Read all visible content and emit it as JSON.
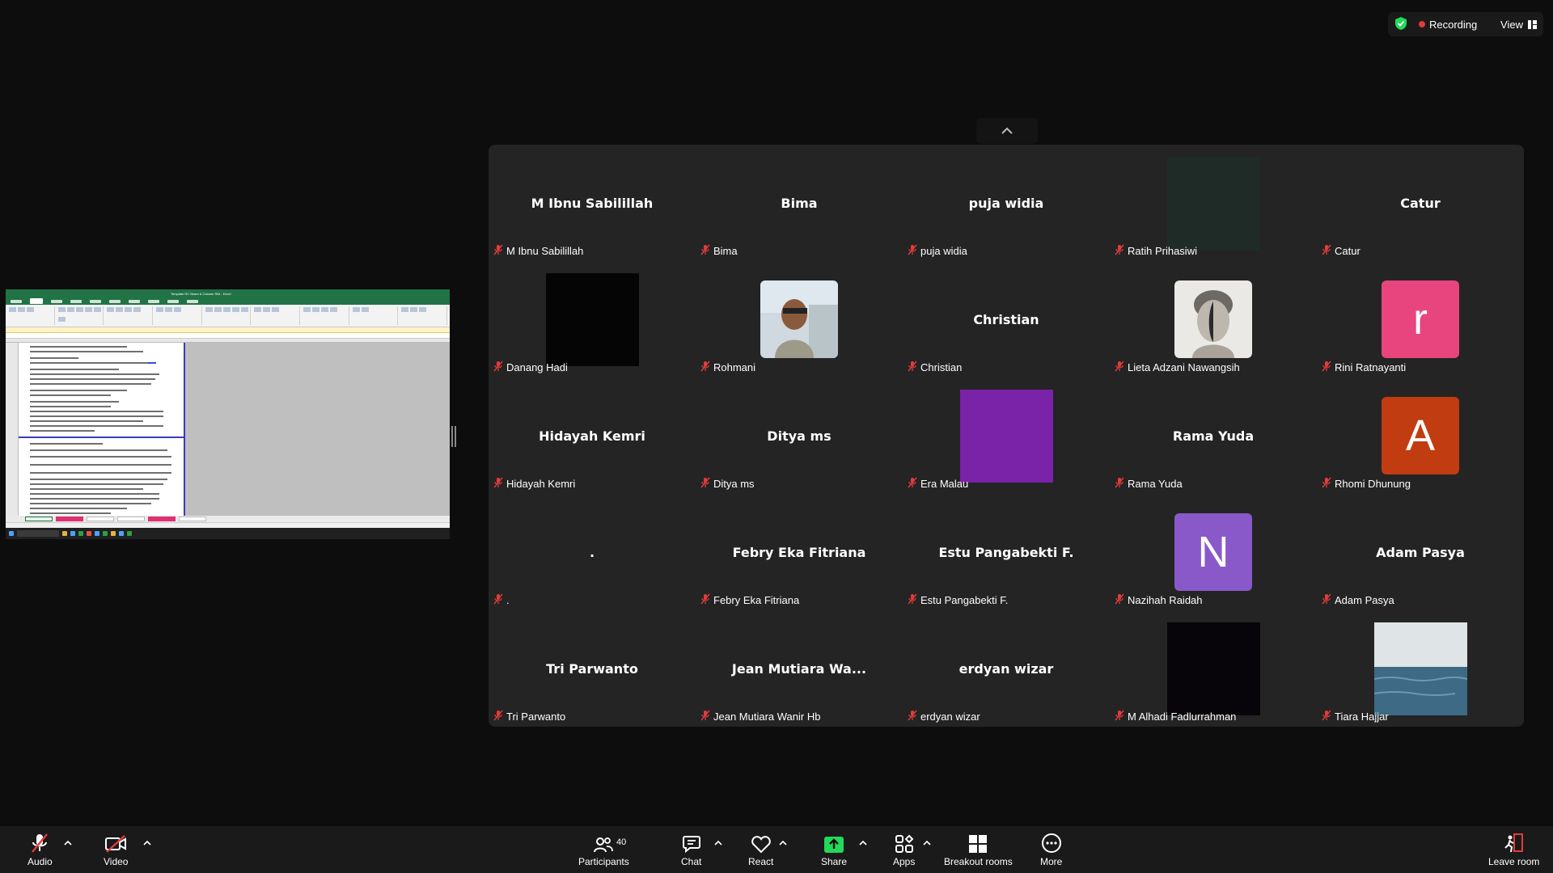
{
  "status": {
    "recording_label": "Recording",
    "view_label": "View",
    "colors": {
      "shield": "#23d959",
      "recording_dot": "#e23b3b"
    }
  },
  "shared_screen": {
    "app": "Microsoft Excel",
    "window_title": "Template RC Beam & Column SNI - Excel"
  },
  "gallery": {
    "tiles": [
      {
        "label": "M Ibnu Sabilillah",
        "display": "M Ibnu Sabilillah",
        "kind": "name"
      },
      {
        "label": "Bima",
        "display": "Bima",
        "kind": "name"
      },
      {
        "label": "puja widia",
        "display": "puja widia",
        "kind": "name"
      },
      {
        "label": "Ratih Prihasiwi",
        "display": "",
        "kind": "video",
        "color": "#1f2b27"
      },
      {
        "label": "Catur",
        "display": "Catur",
        "kind": "name"
      },
      {
        "label": "Danang Hadi",
        "display": "",
        "kind": "video",
        "color": "#050505"
      },
      {
        "label": "Rohmani",
        "display": "",
        "kind": "photo-person"
      },
      {
        "label": "Christian",
        "display": "Christian",
        "kind": "name"
      },
      {
        "label": "Lieta Adzani Nawangsih",
        "display": "",
        "kind": "photo-statue"
      },
      {
        "label": "Rini Ratnayanti",
        "display": "r",
        "kind": "avatar",
        "color": "#e8457e"
      },
      {
        "label": "Hidayah Kemri",
        "display": "Hidayah Kemri",
        "kind": "name"
      },
      {
        "label": "Ditya ms",
        "display": "Ditya ms",
        "kind": "name"
      },
      {
        "label": "Era Malau",
        "display": "",
        "kind": "video",
        "color": "#7a22a8"
      },
      {
        "label": "Rama Yuda",
        "display": "Rama Yuda",
        "kind": "name"
      },
      {
        "label": "Rhomi Dhunung",
        "display": "A",
        "kind": "avatar",
        "color": "#c23c12"
      },
      {
        "label": ".",
        "display": ".",
        "kind": "name"
      },
      {
        "label": "Febry Eka Fitriana",
        "display": "Febry Eka Fitriana",
        "kind": "name"
      },
      {
        "label": "Estu Pangabekti F.",
        "display": "Estu Pangabekti F.",
        "kind": "name"
      },
      {
        "label": "Nazihah Raidah",
        "display": "N",
        "kind": "avatar",
        "color": "#8a59c9"
      },
      {
        "label": "Adam Pasya",
        "display": "Adam Pasya",
        "kind": "name"
      },
      {
        "label": "Tri Parwanto",
        "display": "Tri Parwanto",
        "kind": "name"
      },
      {
        "label": "Jean Mutiara Wanir Hb",
        "display": "Jean Mutiara Wa...",
        "kind": "name"
      },
      {
        "label": "erdyan wizar",
        "display": "erdyan wizar",
        "kind": "name"
      },
      {
        "label": "M Alhadi Fadlurrahman",
        "display": "",
        "kind": "video",
        "color": "#07050a"
      },
      {
        "label": "Tiara Hajjar",
        "display": "",
        "kind": "photo-sea"
      }
    ]
  },
  "toolbar": {
    "audio": "Audio",
    "video": "Video",
    "participants": "Participants",
    "participants_count": "40",
    "chat": "Chat",
    "react": "React",
    "share": "Share",
    "apps": "Apps",
    "breakout": "Breakout rooms",
    "more": "More",
    "leave": "Leave room",
    "colors": {
      "share": "#23d959",
      "muted": "#e23b3b",
      "leave": "#e23b3b"
    }
  }
}
